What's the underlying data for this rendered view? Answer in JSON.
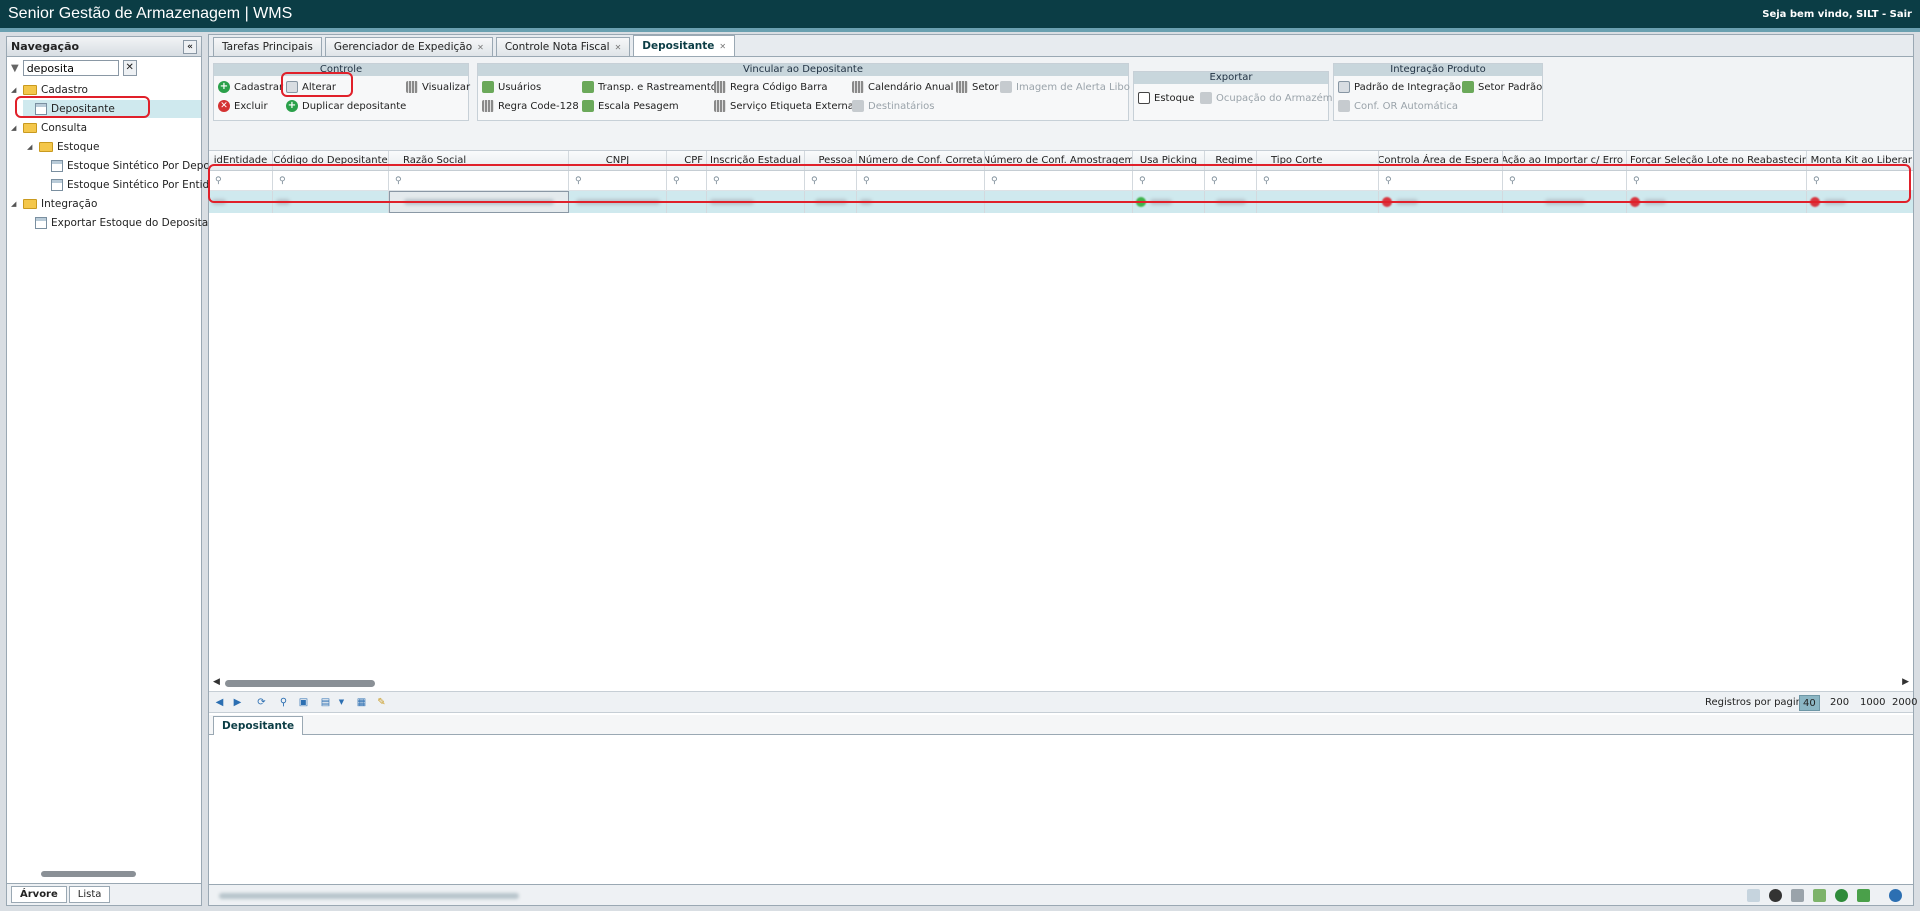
{
  "app": {
    "title": "Senior Gestão de Armazenagem | WMS",
    "welcome": "Seja bem vindo, SILT - Sair"
  },
  "sidebar": {
    "title": "Navegação",
    "filter_value": "deposita",
    "tree": [
      {
        "label": "Cadastro",
        "type": "folder"
      },
      {
        "label": "Depositante",
        "type": "doc",
        "selected": true
      },
      {
        "label": "Consulta",
        "type": "folder"
      },
      {
        "label": "Estoque",
        "type": "folder"
      },
      {
        "label": "Estoque Sintético Por Deposit",
        "type": "doc"
      },
      {
        "label": "Estoque Sintético Por Entidade",
        "type": "doc"
      },
      {
        "label": "Integração",
        "type": "folder"
      },
      {
        "label": "Exportar Estoque do Depositante",
        "type": "doc"
      }
    ],
    "tabs": [
      "Árvore",
      "Lista"
    ]
  },
  "tabs": [
    {
      "label": "Tarefas Principais",
      "closable": false
    },
    {
      "label": "Gerenciador de Expedição",
      "closable": true
    },
    {
      "label": "Controle Nota Fiscal",
      "closable": true
    },
    {
      "label": "Depositante",
      "closable": true,
      "active": true
    }
  ],
  "toolbar": {
    "controle": {
      "title": "Controle",
      "cadastrar": "Cadastrar",
      "alterar": "Alterar",
      "visualizar": "Visualizar",
      "excluir": "Excluir",
      "duplicar": "Duplicar depositante"
    },
    "vincular": {
      "title": "Vincular ao Depositante",
      "usuarios": "Usuários",
      "transp": "Transp. e Rastreamento",
      "regra_codigo_barra": "Regra Código Barra",
      "calendario": "Calendário Anual",
      "setor": "Setor",
      "imagem_alerta": "Imagem de Alerta Libo",
      "regra_code128": "Regra Code-128",
      "escala": "Escala Pesagem",
      "servico_etiqueta": "Serviço Etiqueta Externa",
      "destinatarios": "Destinatários"
    },
    "exportar": {
      "title": "Exportar",
      "estoque": "Estoque",
      "ocupacao": "Ocupação do Armazém"
    },
    "integracao": {
      "title": "Integração Produto",
      "padrao": "Padrão de Integração",
      "setor_padrao": "Setor Padrão",
      "conf_or": "Conf. OR Automática"
    }
  },
  "grid": {
    "columns": [
      "idEntidade",
      "Código do Depositante",
      "Razão Social",
      "CNPJ",
      "CPF",
      "Inscrição Estadual",
      "Pessoa",
      "Número de Conf. Correta",
      "Número de Conf. Amostragem",
      "Usa Picking",
      "Regime",
      "Tipo Corte",
      "Controla Área de Espera",
      "Ação ao Importar c/ Erro",
      "Forçar Seleção Lote no Reabastecim...",
      "Monta Kit ao Liberar"
    ]
  },
  "pager": {
    "label": "Registros por pagina:",
    "options": [
      "40",
      "200",
      "1000",
      "2000"
    ],
    "selected": "40"
  },
  "bottom_tab": "Depositante",
  "colors": {
    "header_bg": "#0b3d45",
    "row_selected": "#cfe9ee",
    "highlight": "#e0202a"
  }
}
